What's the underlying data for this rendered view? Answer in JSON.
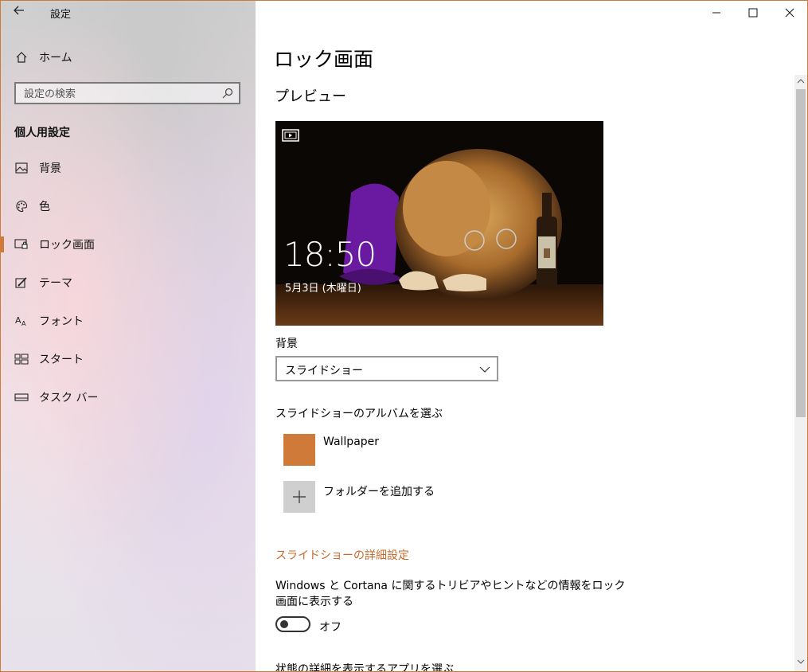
{
  "window": {
    "app_title": "設定",
    "controls": {
      "minimize": "—",
      "maximize": "☐",
      "close": "✕"
    }
  },
  "sidebar": {
    "home": "ホーム",
    "search_placeholder": "設定の検索",
    "section": "個人用設定",
    "items": [
      {
        "label": "背景",
        "icon": "picture-icon"
      },
      {
        "label": "色",
        "icon": "palette-icon"
      },
      {
        "label": "ロック画面",
        "icon": "lock-screen-icon",
        "selected": true
      },
      {
        "label": "テーマ",
        "icon": "theme-brush-icon"
      },
      {
        "label": "フォント",
        "icon": "font-icon"
      },
      {
        "label": "スタート",
        "icon": "start-grid-icon"
      },
      {
        "label": "タスク バー",
        "icon": "taskbar-icon"
      }
    ]
  },
  "main": {
    "title": "ロック画面",
    "preview_heading": "プレビュー",
    "preview": {
      "time": "18:50",
      "date": "5月3日 (木曜日)"
    },
    "background_label": "背景",
    "background_value": "スライドショー",
    "album_label": "スライドショーのアルバムを選ぶ",
    "album_name": "Wallpaper",
    "add_folder": "フォルダーを追加する",
    "advanced_link": "スライドショーの詳細設定",
    "trivia_text": "Windows と Cortana に関するトリビアやヒントなどの情報をロック画面に表示する",
    "toggle_state": "オフ",
    "next_section": "状態の詳細を表示するアプリを選ぶ"
  },
  "colors": {
    "accent": "#d07a3a",
    "link": "#c8692a"
  }
}
